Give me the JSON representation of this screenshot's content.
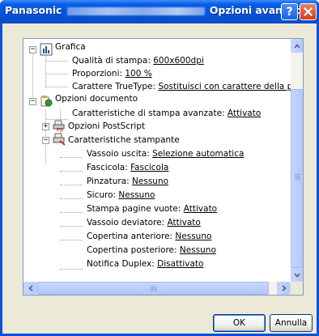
{
  "window": {
    "title_prefix": "Panasonic",
    "title_suffix": "Opzioni avanzate",
    "help_glyph": "?",
    "close_glyph": "✕"
  },
  "tree": {
    "grafica": {
      "label": "Grafica",
      "items": [
        {
          "label": "Qualità di stampa: ",
          "value": "600x600dpi"
        },
        {
          "label": "Proporzioni: ",
          "value": "100 %"
        },
        {
          "label": "Carattere TrueType: ",
          "value": "Sostituisci con carattere della periferica"
        }
      ]
    },
    "opzioni_documento": {
      "label": "Opzioni documento",
      "advanced": {
        "label": "Caratteristiche di stampa avanzate: ",
        "value": "Attivato"
      },
      "postscript": {
        "label": "Opzioni PostScript"
      },
      "caratteristiche": {
        "label": "Caratteristiche stampante",
        "items": [
          {
            "label": "Vassoio uscita: ",
            "value": "Selezione automatica"
          },
          {
            "label": "Fascicola: ",
            "value": "Fascicola"
          },
          {
            "label": "Pinzatura: ",
            "value": "Nessuno"
          },
          {
            "label": "Sicuro: ",
            "value": "Nessuno"
          },
          {
            "label": "Stampa pagine vuote: ",
            "value": "Attivato"
          },
          {
            "label": "Vassoio deviatore: ",
            "value": "Attivato"
          },
          {
            "label": "Copertina anteriore: ",
            "value": "Nessuno"
          },
          {
            "label": "Copertina posteriore: ",
            "value": "Nessuno"
          },
          {
            "label": "Notifica Duplex: ",
            "value": "Disattivato"
          }
        ]
      }
    }
  },
  "buttons": {
    "ok": "OK",
    "cancel": "Annulla"
  },
  "colors": {
    "titlebar": "#0553d9",
    "dialog_bg": "#ece9d8",
    "tree_border": "#7f9db9"
  }
}
